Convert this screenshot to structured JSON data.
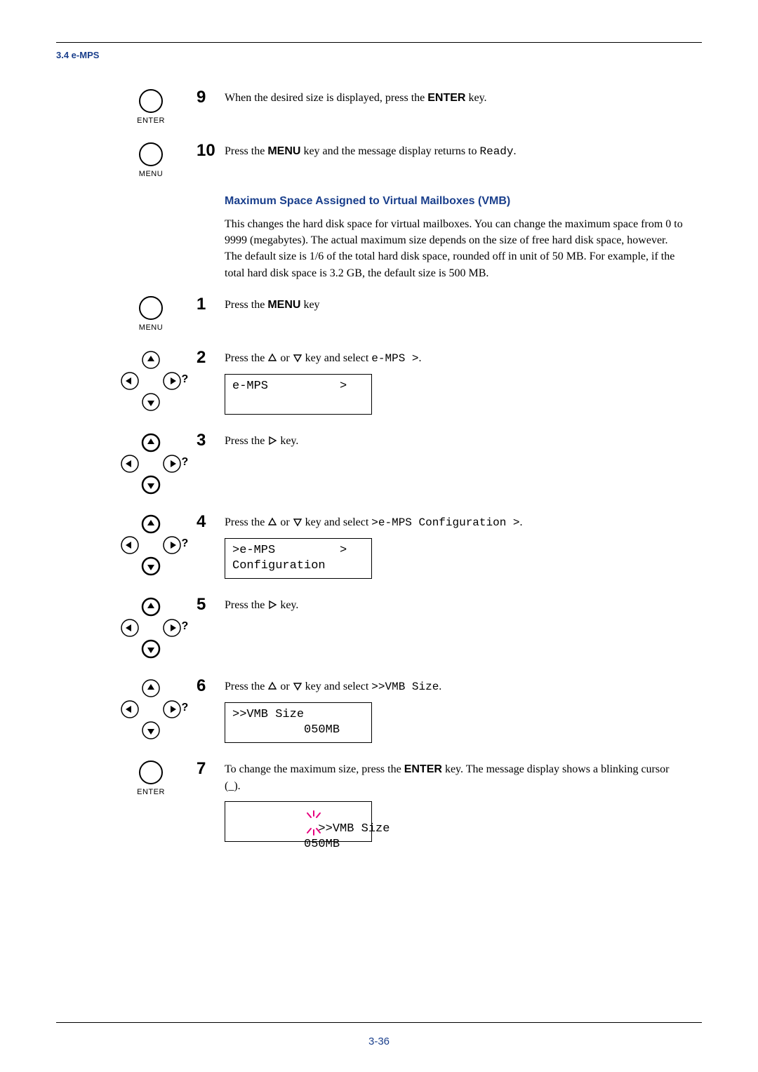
{
  "header": {
    "section": "3.4 e-MPS"
  },
  "page_number": "3-36",
  "steps": {
    "s9": {
      "num": "9",
      "text_pre": "When the desired size is displayed, press the ",
      "bold": "ENTER",
      "text_post": " key."
    },
    "s10": {
      "num": "10",
      "text_pre": "Press the ",
      "bold": "MENU",
      "text_mid": " key and the message display returns to ",
      "mono": "Ready",
      "text_post": "."
    },
    "s1": {
      "num": "1",
      "text_pre": "Press the ",
      "bold": "MENU",
      "text_post": " key"
    },
    "s2": {
      "num": "2",
      "text_pre": "Press the ",
      "text_mid": " or ",
      "text_mid2": " key and select ",
      "mono": "e-MPS >",
      "text_post": ".",
      "lcd": "e-MPS          >"
    },
    "s3": {
      "num": "3",
      "text_pre": "Press the ",
      "text_post": " key."
    },
    "s4": {
      "num": "4",
      "text_pre": "Press the ",
      "text_mid": " or ",
      "text_mid2": " key and select ",
      "mono": ">e-MPS Configuration >",
      "text_post": ".",
      "lcd": ">e-MPS         >\nConfiguration"
    },
    "s5": {
      "num": "5",
      "text_pre": "Press the ",
      "text_post": " key."
    },
    "s6": {
      "num": "6",
      "text_pre": "Press the ",
      "text_mid": " or ",
      "text_mid2": " key and select ",
      "mono": ">>VMB Size",
      "text_post": ".",
      "lcd": ">>VMB Size\n          050MB"
    },
    "s7": {
      "num": "7",
      "text_pre": "To change the maximum size, press the ",
      "bold": "ENTER",
      "text_post": " key. The message display shows a blinking cursor (_).",
      "lcd": ">>VMB Size\n          050MB"
    }
  },
  "vmb_section": {
    "heading": "Maximum Space Assigned to Virtual Mailboxes (VMB)",
    "para": "This changes the hard disk space for virtual mailboxes. You can change the maximum space from 0 to 9999 (megabytes). The actual maximum size depends on the size of free hard disk space, however.  The default size is 1/6 of the total hard disk space, rounded off in unit of 50 MB. For example, if the total hard disk space is 3.2 GB, the default size is 500 MB."
  },
  "key_labels": {
    "enter": "ENTER",
    "menu": "MENU"
  }
}
